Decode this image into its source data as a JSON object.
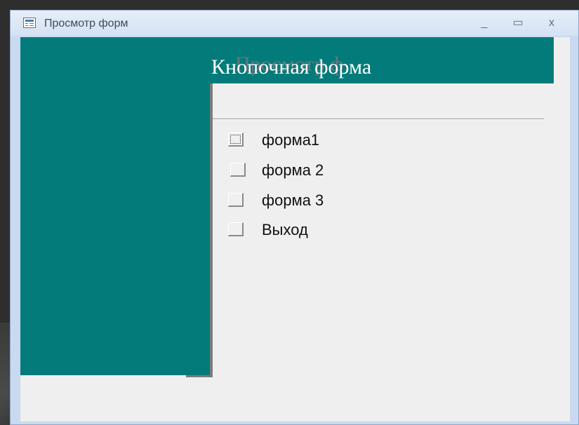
{
  "window": {
    "title": "Просмотр форм",
    "controls": {
      "minimize": "_",
      "maximize": "▭",
      "close": "x"
    }
  },
  "switchboard": {
    "title": "Кнопочная форма",
    "ghost_title": "Просмотр ф",
    "items": [
      {
        "label": "форма1",
        "focused": true
      },
      {
        "label": "форма 2",
        "focused": false
      },
      {
        "label": "форма 3",
        "focused": false
      },
      {
        "label": "Выход",
        "focused": false
      }
    ]
  },
  "colors": {
    "accent_teal": "#027b7a",
    "client_bg": "#efefef",
    "titlebar": "#d5e2f3"
  }
}
